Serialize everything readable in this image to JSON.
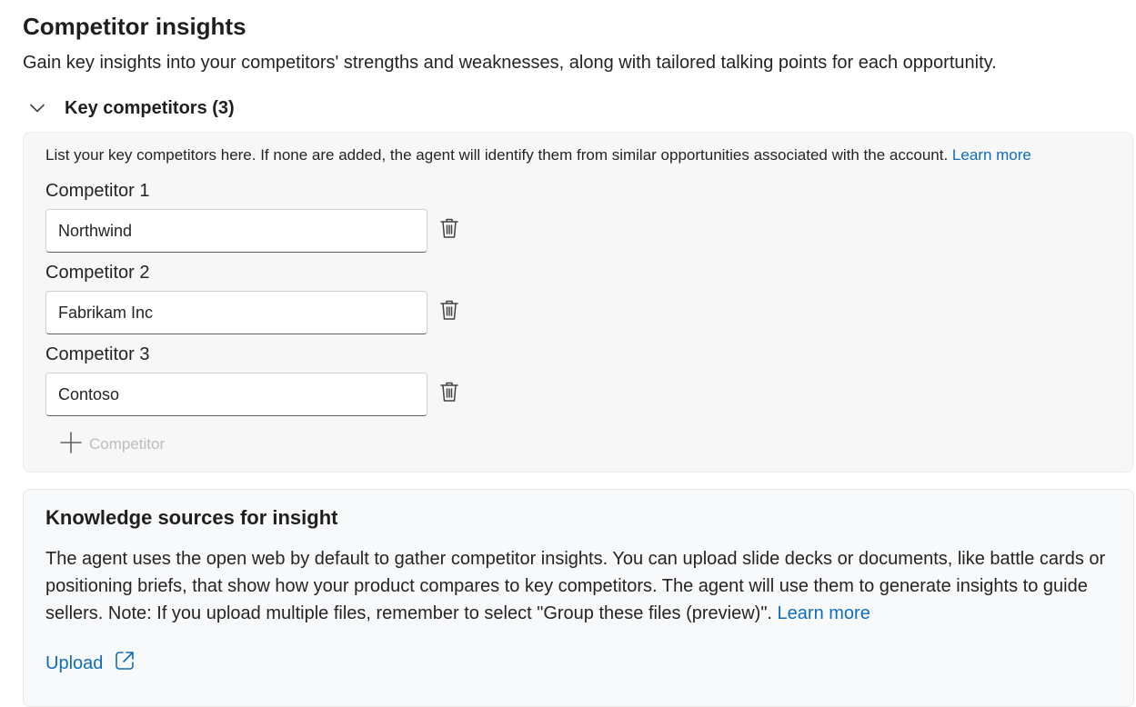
{
  "page": {
    "title": "Competitor insights",
    "subtitle": "Gain key insights into your competitors' strengths and weaknesses, along with tailored talking points for each opportunity."
  },
  "key_competitors": {
    "header": "Key competitors (3)",
    "expanded": true,
    "description": "List your key competitors here. If none are added, the agent will identify them from similar opportunities associated with the account.",
    "learn_more": "Learn more",
    "competitors": [
      {
        "label": "Competitor 1",
        "value": "Northwind"
      },
      {
        "label": "Competitor 2",
        "value": "Fabrikam Inc"
      },
      {
        "label": "Competitor 3",
        "value": "Contoso"
      }
    ],
    "add_label": "Competitor",
    "add_enabled": false
  },
  "knowledge_sources": {
    "title": "Knowledge sources for insight",
    "text": "The agent uses the open web by default to gather competitor insights. You can upload slide decks or documents, like battle cards or positioning briefs, that show how your product compares to key competitors. The agent will use them to generate insights to guide sellers. Note: If you upload multiple files, remember to select \"Group these files (preview)\".",
    "learn_more": "Learn more",
    "upload_label": "Upload"
  },
  "icons": {
    "collapse": "chevron-down-icon",
    "delete": "trash-icon",
    "add": "plus-icon",
    "open_external": "open-external-icon"
  },
  "colors": {
    "link": "#0f6cbd",
    "panel_bg": "#f7f7f7",
    "disabled_text": "#bdbdbd"
  }
}
